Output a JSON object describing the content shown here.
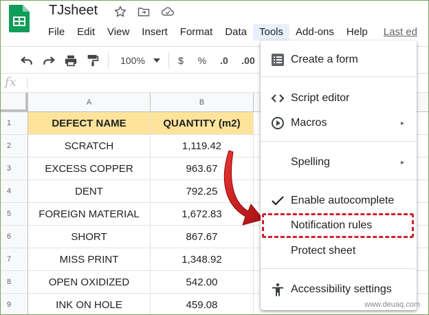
{
  "header": {
    "title": "TJsheet",
    "icons": [
      "star-icon",
      "move-to-folder-icon",
      "cloud-status-icon"
    ]
  },
  "menubar": {
    "items": [
      "File",
      "Edit",
      "View",
      "Insert",
      "Format",
      "Data",
      "Tools",
      "Add-ons",
      "Help"
    ],
    "active": "Tools",
    "last_edit": "Last ed"
  },
  "toolbar": {
    "zoom": "100%",
    "currency": "$",
    "percent": "%",
    "decrease_decimal": ".0",
    "increase_decimal": ".00",
    "icons": [
      "undo-icon",
      "redo-icon",
      "print-icon",
      "paint-format-icon",
      "zoom-dropdown-icon"
    ]
  },
  "formula_bar": {
    "label": "fx"
  },
  "grid": {
    "columns": [
      "A",
      "B"
    ],
    "rows": [
      {
        "n": "1",
        "a": "DEFECT NAME",
        "b": "QUANTITY (m2)"
      },
      {
        "n": "2",
        "a": "SCRATCH",
        "b": "1,119.42"
      },
      {
        "n": "3",
        "a": "EXCESS COPPER",
        "b": "963.67"
      },
      {
        "n": "4",
        "a": "DENT",
        "b": "792.25"
      },
      {
        "n": "5",
        "a": "FOREIGN MATERIAL",
        "b": "1,672.83"
      },
      {
        "n": "6",
        "a": "SHORT",
        "b": "867.67"
      },
      {
        "n": "7",
        "a": "MISS PRINT",
        "b": "1,348.92"
      },
      {
        "n": "8",
        "a": "OPEN OXIDIZED",
        "b": "542.00"
      },
      {
        "n": "9",
        "a": "INK ON HOLE",
        "b": "459.08"
      }
    ]
  },
  "tools_menu": {
    "items": [
      {
        "label": "Create a form",
        "icon": "form-icon"
      },
      {
        "label": "Script editor",
        "icon": "code-icon"
      },
      {
        "label": "Macros",
        "icon": "play-circle-icon"
      },
      {
        "label": "Spelling",
        "icon": ""
      },
      {
        "label": "Enable autocomplete",
        "icon": "checkmark-icon"
      },
      {
        "label": "Notification rules",
        "icon": ""
      },
      {
        "label": "Protect sheet",
        "icon": ""
      },
      {
        "label": "Accessibility settings",
        "icon": "accessibility-icon"
      }
    ],
    "submenu_arrow": "▸"
  },
  "colors": {
    "header_fill": "#fde49a",
    "highlight": "#d0202a",
    "sheets_green": "#0f9d58"
  },
  "watermark": "www.deuaq.com"
}
